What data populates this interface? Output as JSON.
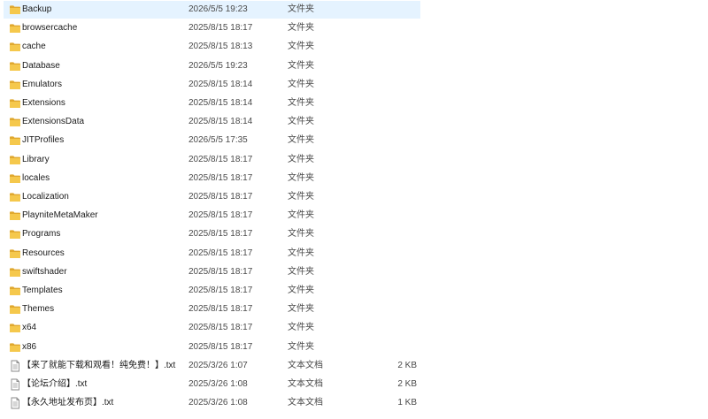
{
  "files": [
    {
      "name": "Backup",
      "date": "2026/5/5 19:23",
      "type": "文件夹",
      "size": "",
      "icon": "folder-icon",
      "selected": true
    },
    {
      "name": "browsercache",
      "date": "2025/8/15 18:17",
      "type": "文件夹",
      "size": "",
      "icon": "folder-icon"
    },
    {
      "name": "cache",
      "date": "2025/8/15 18:13",
      "type": "文件夹",
      "size": "",
      "icon": "folder-icon"
    },
    {
      "name": "Database",
      "date": "2026/5/5 19:23",
      "type": "文件夹",
      "size": "",
      "icon": "folder-icon"
    },
    {
      "name": "Emulators",
      "date": "2025/8/15 18:14",
      "type": "文件夹",
      "size": "",
      "icon": "folder-icon"
    },
    {
      "name": "Extensions",
      "date": "2025/8/15 18:14",
      "type": "文件夹",
      "size": "",
      "icon": "folder-icon"
    },
    {
      "name": "ExtensionsData",
      "date": "2025/8/15 18:14",
      "type": "文件夹",
      "size": "",
      "icon": "folder-icon"
    },
    {
      "name": "JITProfiles",
      "date": "2026/5/5 17:35",
      "type": "文件夹",
      "size": "",
      "icon": "folder-icon"
    },
    {
      "name": "Library",
      "date": "2025/8/15 18:17",
      "type": "文件夹",
      "size": "",
      "icon": "folder-icon"
    },
    {
      "name": "locales",
      "date": "2025/8/15 18:17",
      "type": "文件夹",
      "size": "",
      "icon": "folder-icon"
    },
    {
      "name": "Localization",
      "date": "2025/8/15 18:17",
      "type": "文件夹",
      "size": "",
      "icon": "folder-icon"
    },
    {
      "name": "PlayniteMetaMaker",
      "date": "2025/8/15 18:17",
      "type": "文件夹",
      "size": "",
      "icon": "folder-icon"
    },
    {
      "name": "Programs",
      "date": "2025/8/15 18:17",
      "type": "文件夹",
      "size": "",
      "icon": "folder-icon"
    },
    {
      "name": "Resources",
      "date": "2025/8/15 18:17",
      "type": "文件夹",
      "size": "",
      "icon": "folder-icon"
    },
    {
      "name": "swiftshader",
      "date": "2025/8/15 18:17",
      "type": "文件夹",
      "size": "",
      "icon": "folder-icon"
    },
    {
      "name": "Templates",
      "date": "2025/8/15 18:17",
      "type": "文件夹",
      "size": "",
      "icon": "folder-icon"
    },
    {
      "name": "Themes",
      "date": "2025/8/15 18:17",
      "type": "文件夹",
      "size": "",
      "icon": "folder-icon"
    },
    {
      "name": "x64",
      "date": "2025/8/15 18:17",
      "type": "文件夹",
      "size": "",
      "icon": "folder-icon"
    },
    {
      "name": "x86",
      "date": "2025/8/15 18:17",
      "type": "文件夹",
      "size": "",
      "icon": "folder-icon"
    },
    {
      "name": "【来了就能下载和观看！纯免费！】.txt",
      "date": "2025/3/26 1:07",
      "type": "文本文档",
      "size": "2 KB",
      "icon": "text-file-icon"
    },
    {
      "name": "【论坛介绍】.txt",
      "date": "2025/3/26 1:08",
      "type": "文本文档",
      "size": "2 KB",
      "icon": "text-file-icon"
    },
    {
      "name": "【永久地址发布页】.txt",
      "date": "2025/3/26 1:08",
      "type": "文本文档",
      "size": "1 KB",
      "icon": "text-file-icon"
    }
  ],
  "colors": {
    "selected_row": "#e5f3ff",
    "folder": "#f5c84c",
    "folder_dark": "#e0a82e"
  }
}
